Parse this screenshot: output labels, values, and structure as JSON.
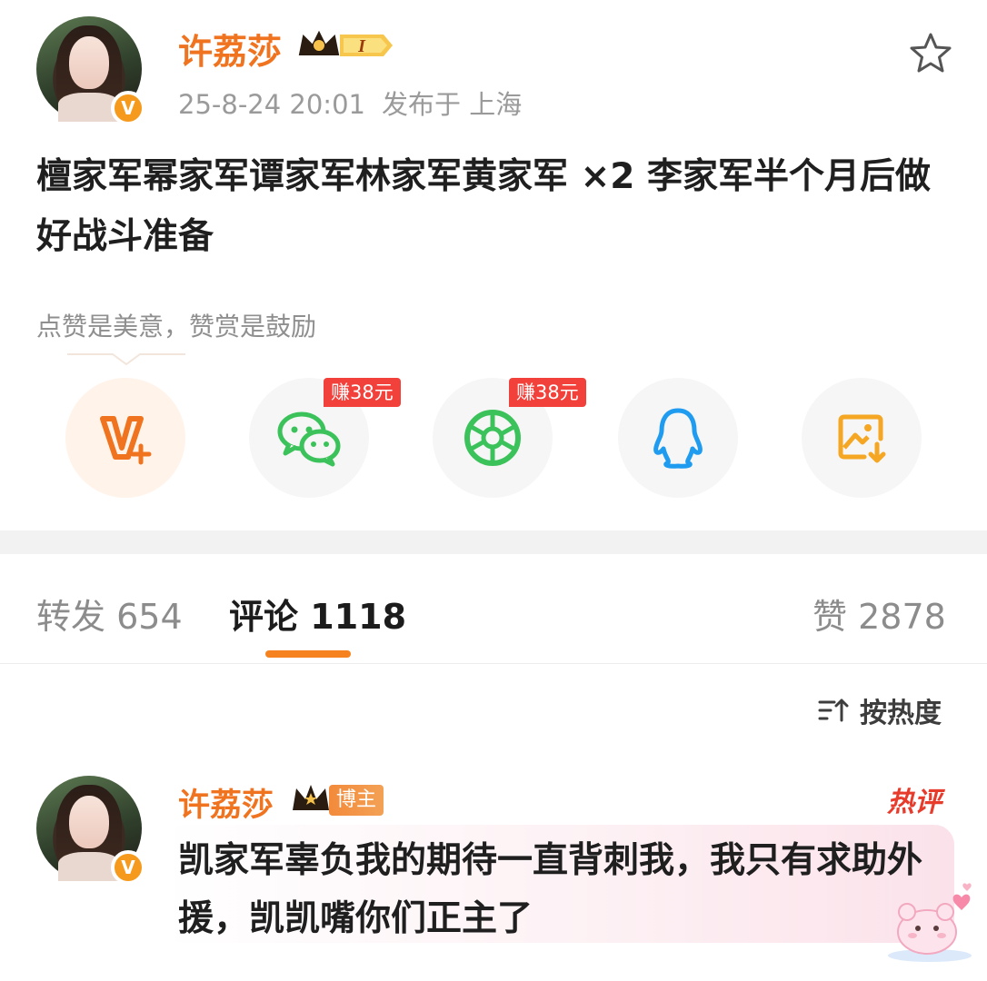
{
  "post": {
    "author": {
      "name": "许荔莎",
      "level_badge": "I",
      "verified_mark": "V"
    },
    "meta": {
      "time": "25-8-24 20:01",
      "location": "发布于 上海"
    },
    "text": "檀家军幂家军谭家军林家军黄家军 ×2 李家军半个月后做好战斗准备",
    "reward_prompt": "点赞是美意，赞赏是鼓励",
    "favorite_icon": "star-outline-icon"
  },
  "share": {
    "items": [
      {
        "icon": "vplus-icon",
        "badge": ""
      },
      {
        "icon": "wechat-icon",
        "badge": "赚38元"
      },
      {
        "icon": "moments-icon",
        "badge": "赚38元"
      },
      {
        "icon": "qq-icon",
        "badge": ""
      },
      {
        "icon": "save-image-icon",
        "badge": ""
      }
    ]
  },
  "tabs": {
    "repost_label": "转发",
    "repost_count": "654",
    "comment_label": "评论",
    "comment_count": "1118",
    "like_label": "赞",
    "like_count": "2878"
  },
  "sort": {
    "label": "按热度",
    "icon": "sort-icon"
  },
  "comments": [
    {
      "author": "许荔莎",
      "author_tag": "博主",
      "hot_label": "热评",
      "text": "凯家军辜负我的期待一直背刺我，我只有求助外援，凯凯嘴你们正主了",
      "verified_mark": "V"
    }
  ],
  "colors": {
    "brand_orange": "#f0731f",
    "accent_underline": "#f5821f",
    "wechat_green": "#3cc25a",
    "qq_blue": "#1f9bf0",
    "earn_badge_red": "#f2403a",
    "hot_red": "#e73b2c"
  }
}
